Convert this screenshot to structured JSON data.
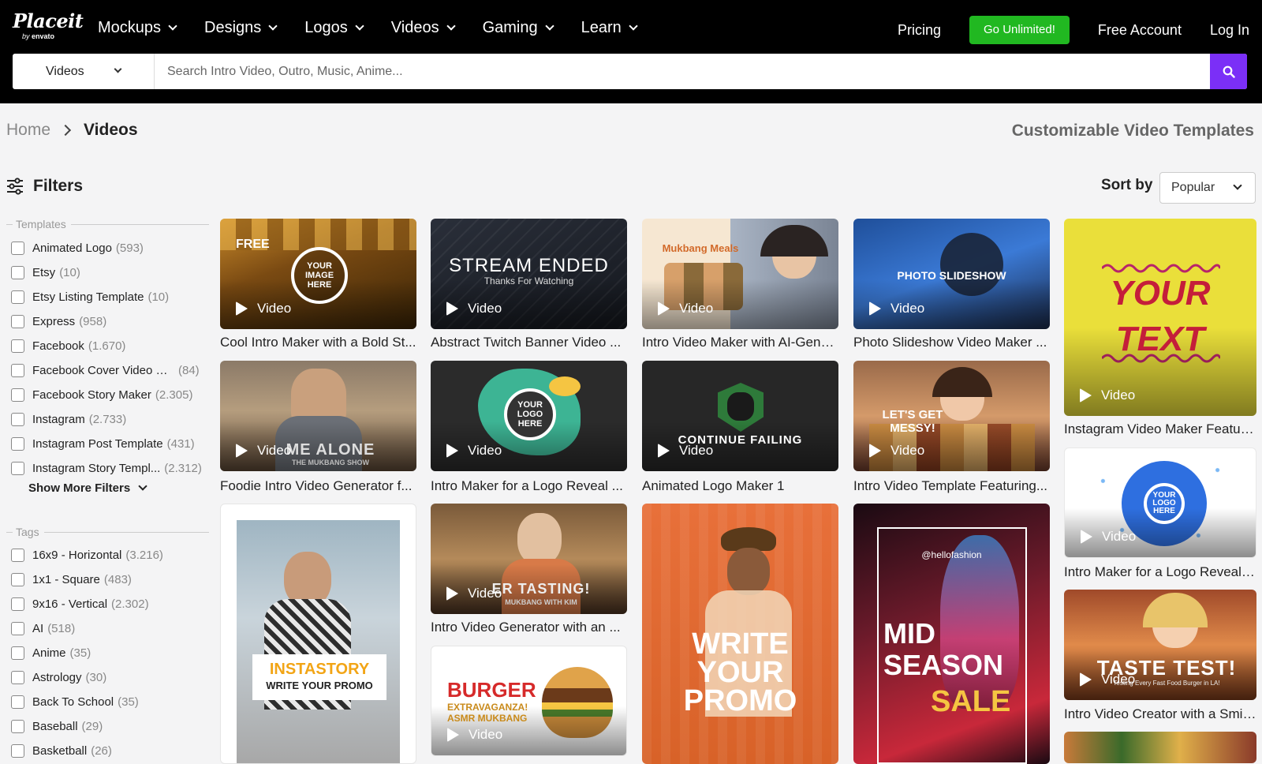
{
  "brand": {
    "name": "Placeit",
    "by": "by",
    "parent": "envato"
  },
  "nav": {
    "items": [
      {
        "label": "Mockups"
      },
      {
        "label": "Designs"
      },
      {
        "label": "Logos"
      },
      {
        "label": "Videos"
      },
      {
        "label": "Gaming"
      },
      {
        "label": "Learn"
      }
    ],
    "pricing": "Pricing",
    "cta": "Go Unlimited!",
    "free_account": "Free Account",
    "login": "Log In"
  },
  "search": {
    "category": "Videos",
    "placeholder": "Search Intro Video, Outro, Music, Anime..."
  },
  "breadcrumb": {
    "home": "Home",
    "current": "Videos"
  },
  "page_heading": "Customizable Video Templates",
  "filters": {
    "title": "Filters",
    "templates_label": "Templates",
    "templates": [
      {
        "name": "Animated Logo",
        "count": "(593)"
      },
      {
        "name": "Etsy",
        "count": "(10)"
      },
      {
        "name": "Etsy Listing Template",
        "count": "(10)"
      },
      {
        "name": "Express",
        "count": "(958)"
      },
      {
        "name": "Facebook",
        "count": "(1.670)"
      },
      {
        "name": "Facebook Cover Video Ma...",
        "count": "(84)"
      },
      {
        "name": "Facebook Story Maker",
        "count": "(2.305)"
      },
      {
        "name": "Instagram",
        "count": "(2.733)"
      },
      {
        "name": "Instagram Post Template",
        "count": "(431)"
      },
      {
        "name": "Instagram Story Templ...",
        "count": "(2.312)"
      }
    ],
    "show_more": "Show More Filters",
    "tags_label": "Tags",
    "tags": [
      {
        "name": "16x9 - Horizontal",
        "count": "(3.216)"
      },
      {
        "name": "1x1 - Square",
        "count": "(483)"
      },
      {
        "name": "9x16 - Vertical",
        "count": "(2.302)"
      },
      {
        "name": "AI",
        "count": "(518)"
      },
      {
        "name": "Anime",
        "count": "(35)"
      },
      {
        "name": "Astrology",
        "count": "(30)"
      },
      {
        "name": "Back To School",
        "count": "(35)"
      },
      {
        "name": "Baseball",
        "count": "(29)"
      },
      {
        "name": "Basketball",
        "count": "(26)"
      }
    ]
  },
  "sort": {
    "label": "Sort by",
    "value": "Popular"
  },
  "video_badge": "Video",
  "cards": [
    {
      "title": "Cool Intro Maker with a Bold St...",
      "free": "FREE",
      "overlay": "YOUR IMAGE HERE"
    },
    {
      "title": "Abstract Twitch Banner Video ...",
      "overlay": "STREAM ENDED",
      "overlay2": "Thanks For Watching"
    },
    {
      "title": "Intro Video Maker with AI-Gene...",
      "overlay": "Mukbang Meals"
    },
    {
      "title": "Photo Slideshow Video Maker ...",
      "overlay": "PHOTO SLIDESHOW"
    },
    {
      "title": "Instagram Video Maker Featuri...",
      "overlay": "YOUR",
      "overlay2": "TEXT"
    },
    {
      "title": "Foodie Intro Video Generator f...",
      "overlay": "ME ALONE",
      "overlay2": "THE MUKBANG SHOW"
    },
    {
      "title": "Intro Maker for a Logo Reveal ...",
      "overlay": "YOUR LOGO HERE"
    },
    {
      "title": "Animated Logo Maker 1",
      "overlay": "CONTINUE FAILING"
    },
    {
      "title": "Intro Video Template Featuring...",
      "overlay": "LET'S GET MESSY!"
    },
    {
      "title": "Intro Maker for a Logo Reveal F...",
      "overlay": "YOUR LOGO HERE"
    },
    {
      "title": "Intro Video Generator with an ...",
      "overlay": "ER TASTING!",
      "overlay2": "MUKBANG WITH KIM"
    },
    {
      "title": "Intro Video Creator with a Smili...",
      "overlay": "TASTE TEST!",
      "overlay2": "Testing Every Fast Food Burger in LA!"
    },
    {
      "overlay": "INSTASTORY",
      "overlay2": "WRITE YOUR PROMO"
    },
    {
      "overlay": "BURGER",
      "overlay2": "EXTRAVAGANZA! ASMR MUKBANG"
    },
    {
      "overlay": "WRITE YOUR PROMO"
    },
    {
      "overlay": "MID SEASON",
      "overlay2": "SALE",
      "overlay3": "@hellofashion"
    }
  ],
  "colors": {
    "accent": "#7b2ff7",
    "cta": "#21b821",
    "nav_bg": "#000000"
  }
}
